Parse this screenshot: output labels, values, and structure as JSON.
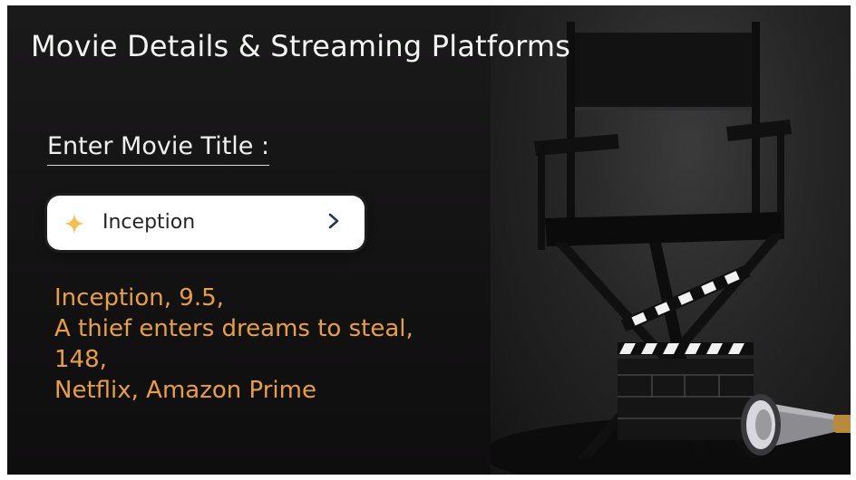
{
  "app": {
    "title": "Movie Details & Streaming Platforms"
  },
  "form": {
    "label": "Enter Movie Title :",
    "input_value": "Inception",
    "input_icon": "sparkle-icon",
    "submit_icon": "chevron-right-icon"
  },
  "result": {
    "lines": [
      "Inception, 9.5,",
      "A thief enters dreams to steal,",
      "148,",
      "Netflix, Amazon Prime"
    ]
  },
  "colors": {
    "background": "#141214",
    "result_text": "#e8a03e",
    "sparkle": "#f5c04a",
    "chevron": "#1f3a4d"
  }
}
